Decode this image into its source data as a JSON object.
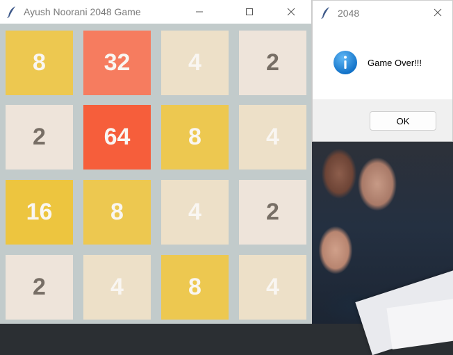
{
  "game_window": {
    "title": "Ayush Noorani 2048 Game",
    "minimize_glyph": "—",
    "maximize_glyph": "☐",
    "close_glyph": "✕",
    "board": {
      "rows": [
        [
          {
            "value": "8",
            "bg": "#edc850",
            "fg": "#f9f6f2"
          },
          {
            "value": "32",
            "bg": "#f67c5f",
            "fg": "#f9f6f2"
          },
          {
            "value": "4",
            "bg": "#ede0c8",
            "fg": "#f9f6f2"
          },
          {
            "value": "2",
            "bg": "#eee4da",
            "fg": "#776e65"
          }
        ],
        [
          {
            "value": "2",
            "bg": "#eee4da",
            "fg": "#776e65"
          },
          {
            "value": "64",
            "bg": "#f65e3b",
            "fg": "#f9f6f2"
          },
          {
            "value": "8",
            "bg": "#edc850",
            "fg": "#f9f6f2"
          },
          {
            "value": "4",
            "bg": "#ede0c8",
            "fg": "#f9f6f2"
          }
        ],
        [
          {
            "value": "16",
            "bg": "#edc53f",
            "fg": "#f9f6f2"
          },
          {
            "value": "8",
            "bg": "#edc850",
            "fg": "#f9f6f2"
          },
          {
            "value": "4",
            "bg": "#ede0c8",
            "fg": "#f9f6f2"
          },
          {
            "value": "2",
            "bg": "#eee4da",
            "fg": "#776e65"
          }
        ],
        [
          {
            "value": "2",
            "bg": "#eee4da",
            "fg": "#776e65"
          },
          {
            "value": "4",
            "bg": "#ede0c8",
            "fg": "#f9f6f2"
          },
          {
            "value": "8",
            "bg": "#edc850",
            "fg": "#f9f6f2"
          },
          {
            "value": "4",
            "bg": "#ede0c8",
            "fg": "#f9f6f2"
          }
        ]
      ],
      "background": "#c2cbcb"
    }
  },
  "dialog": {
    "title": "2048",
    "close_glyph": "✕",
    "icon": "info-icon",
    "message": "Game Over!!!",
    "ok_label": "OK",
    "accent": "#1a86e0"
  }
}
